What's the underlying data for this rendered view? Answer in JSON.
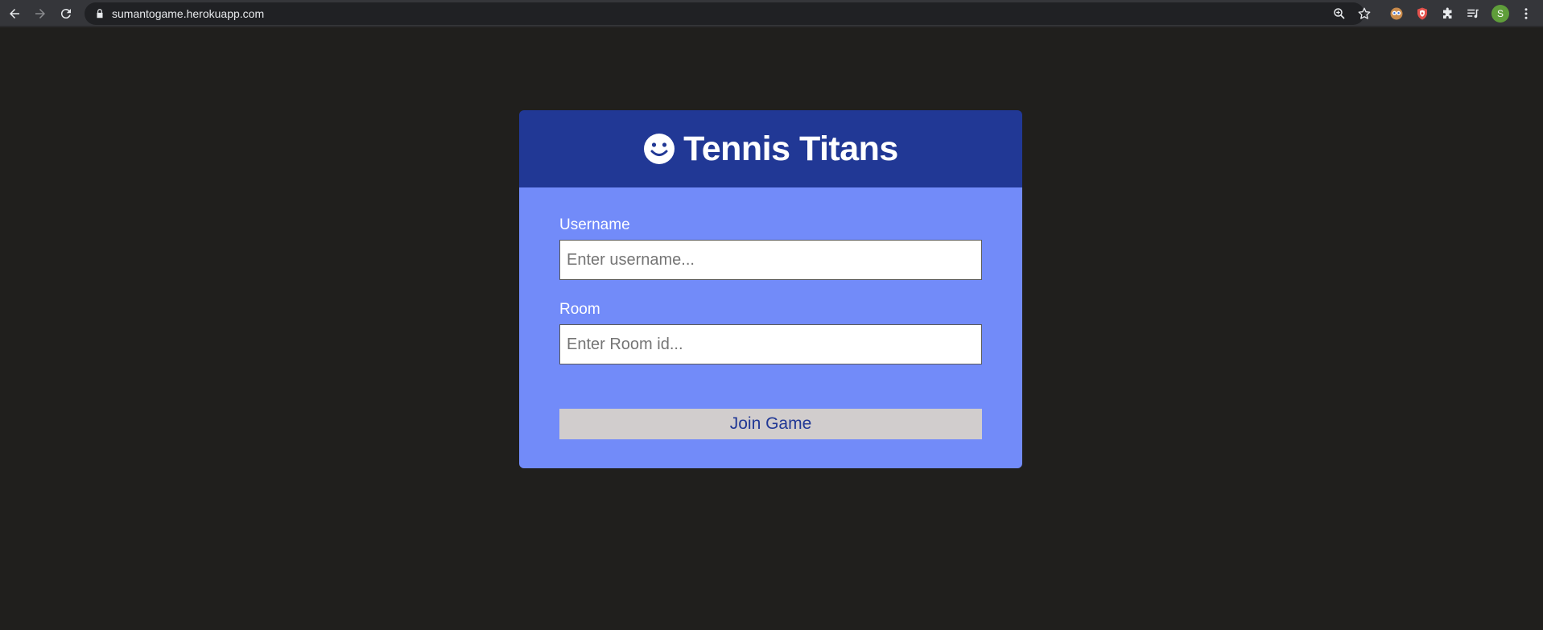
{
  "browser": {
    "url": "sumantogame.herokuapp.com",
    "avatar_letter": "S",
    "icons": {
      "back": "arrow-left-icon",
      "forward": "arrow-right-icon",
      "reload": "reload-icon",
      "lock": "lock-icon",
      "zoom": "zoom-icon",
      "bookmark": "star-icon",
      "extensions": [
        "owl-extension-icon",
        "shield-extension-icon",
        "puzzle-icon",
        "media-queue-icon"
      ],
      "menu": "kebab-menu-icon"
    },
    "colors": {
      "toolbar": "#35363a",
      "omnibox": "#202124",
      "icon": "#e8eaed",
      "icon_disabled": "#8a8b8e",
      "avatar": "#5f9e3a"
    }
  },
  "app": {
    "title": "Tennis Titans",
    "header_icon": "smiley-icon",
    "form": {
      "username_label": "Username",
      "username_placeholder": "Enter username...",
      "username_value": "",
      "room_label": "Room",
      "room_placeholder": "Enter Room id...",
      "room_value": "",
      "join_label": "Join Game"
    },
    "colors": {
      "page_background": "#201f1d",
      "header_background": "#213895",
      "body_background": "#728bf9",
      "button_background": "#d1cdcd",
      "button_text": "#213895"
    }
  }
}
